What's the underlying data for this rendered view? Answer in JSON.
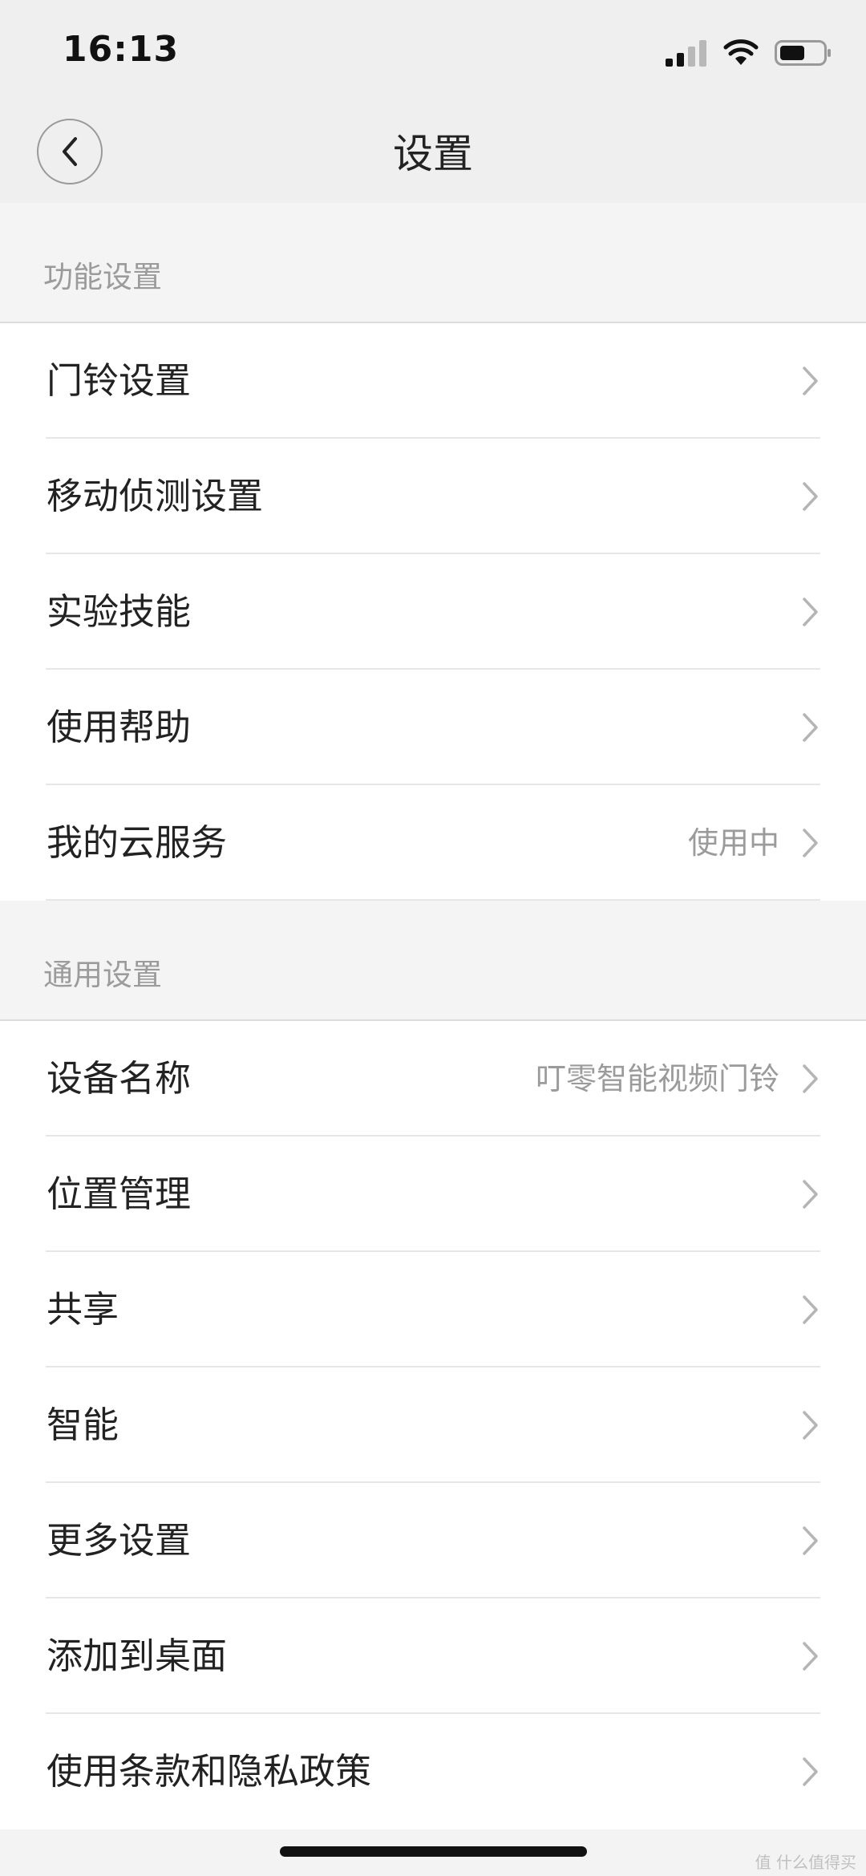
{
  "status_bar": {
    "time": "16:13",
    "signal_icon": "signal-icon",
    "wifi_icon": "wifi-icon",
    "battery_icon": "battery-icon"
  },
  "nav": {
    "back_icon": "chevron-left-icon",
    "title": "设置"
  },
  "sections": {
    "function": {
      "header": "功能设置",
      "items": [
        {
          "label": "门铃设置",
          "value": ""
        },
        {
          "label": "移动侦测设置",
          "value": ""
        },
        {
          "label": "实验技能",
          "value": ""
        },
        {
          "label": "使用帮助",
          "value": ""
        },
        {
          "label": "我的云服务",
          "value": "使用中"
        }
      ]
    },
    "general": {
      "header": "通用设置",
      "items": [
        {
          "label": "设备名称",
          "value": "叮零智能视频门铃"
        },
        {
          "label": "位置管理",
          "value": ""
        },
        {
          "label": "共享",
          "value": ""
        },
        {
          "label": "智能",
          "value": ""
        },
        {
          "label": "更多设置",
          "value": ""
        },
        {
          "label": "添加到桌面",
          "value": ""
        },
        {
          "label": "使用条款和隐私政策",
          "value": ""
        }
      ]
    }
  },
  "watermark": "值 什么值得买"
}
